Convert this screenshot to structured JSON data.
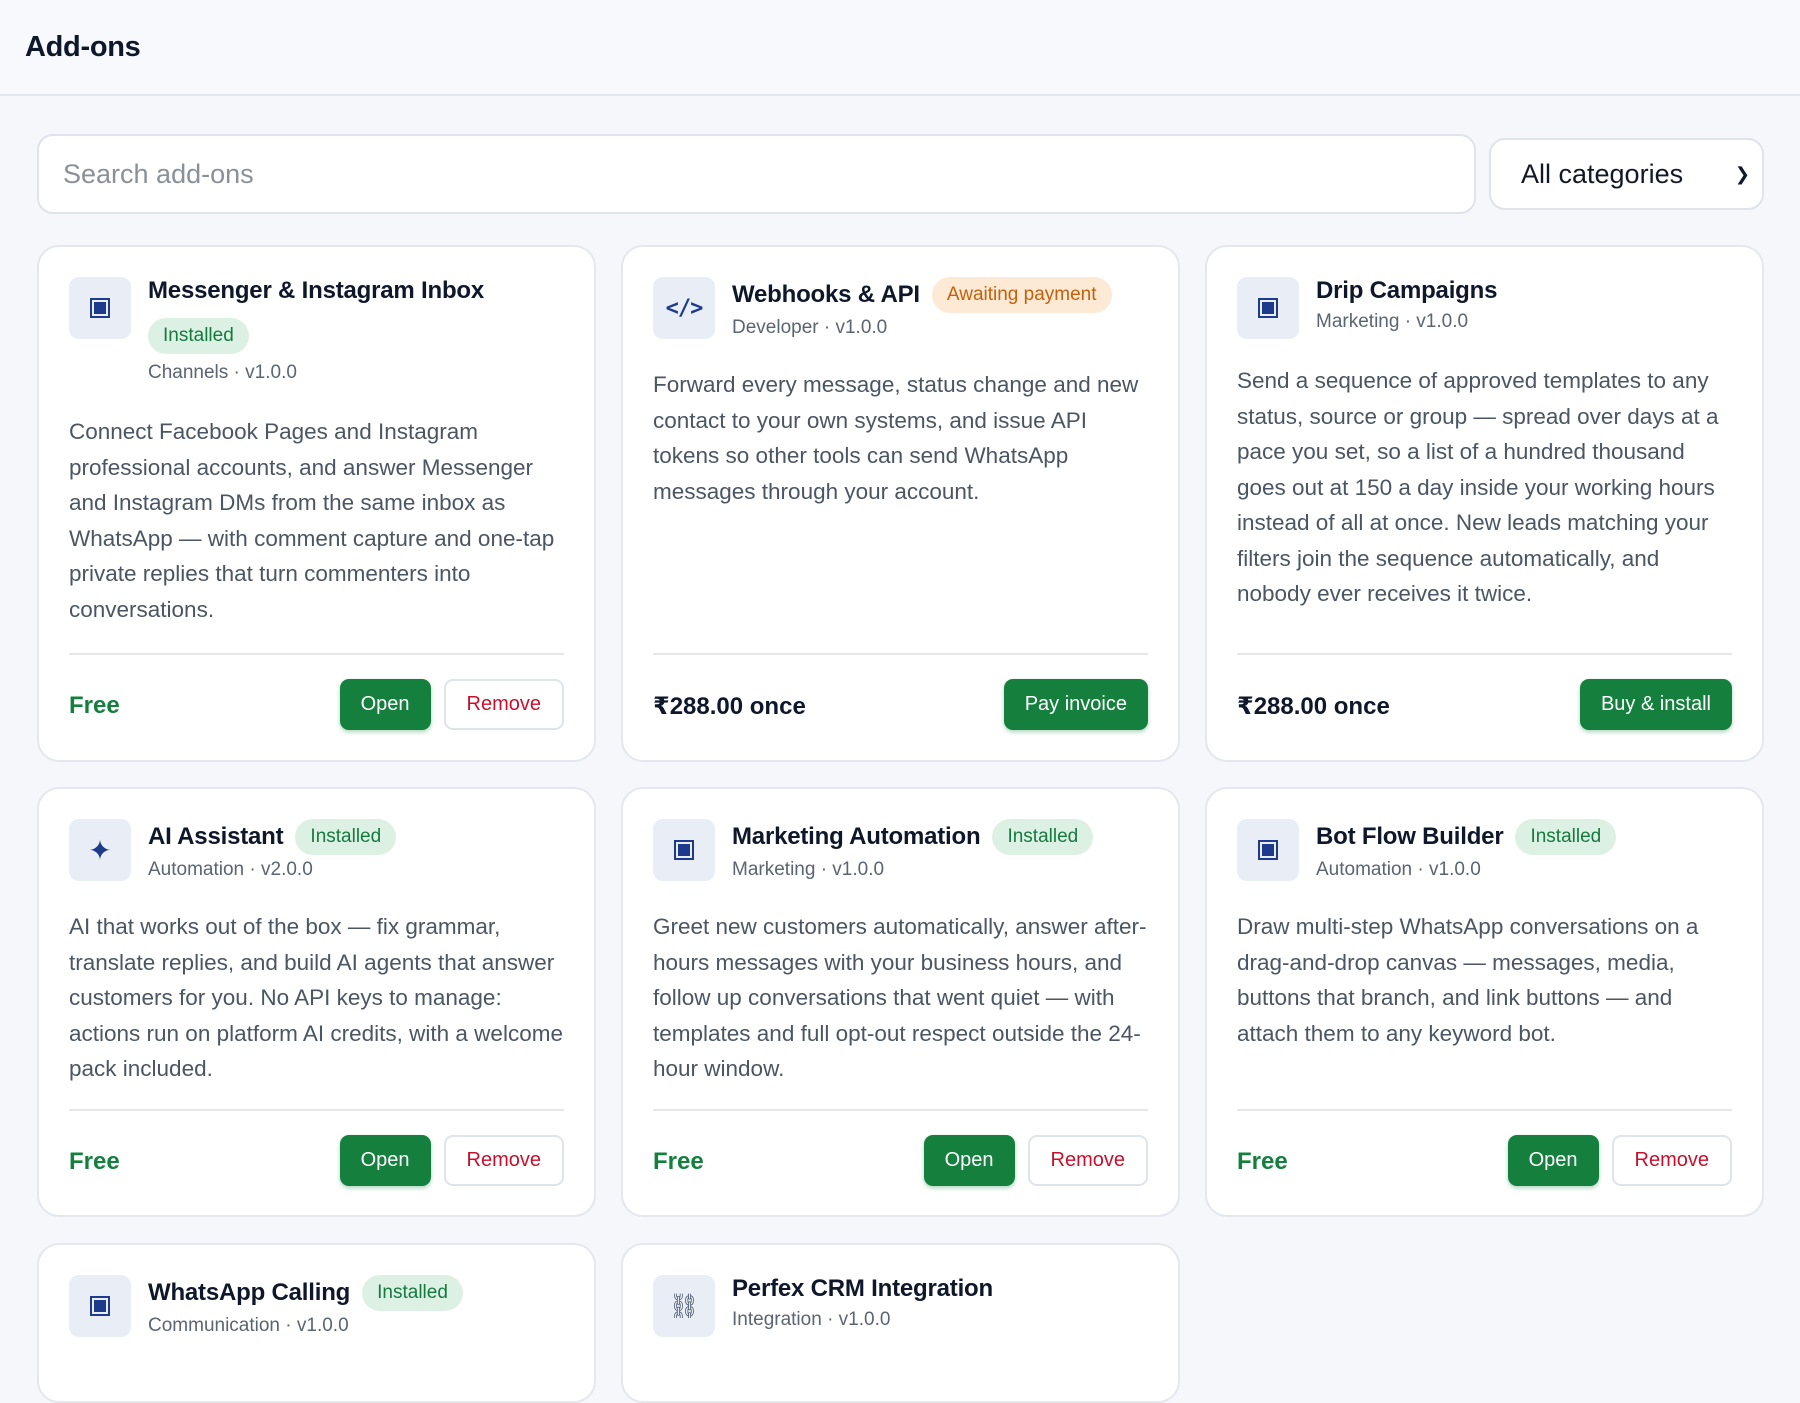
{
  "header": {
    "title": "Add-ons"
  },
  "search": {
    "placeholder": "Search add-ons"
  },
  "category_filter": {
    "selected": "All categories"
  },
  "cards": [
    {
      "title": "Messenger & Instagram Inbox",
      "badge": "Installed",
      "meta": "Channels · v1.0.0",
      "description": "Connect Facebook Pages and Instagram professional accounts, and answer Messenger and Instagram DMs from the same inbox as WhatsApp — with comment capture and one-tap private replies that turn commenters into conversations.",
      "price": "Free",
      "primary_button": "Open",
      "secondary_button": "Remove",
      "icon": "square-icon"
    },
    {
      "title": "Webhooks & API",
      "badge": "Awaiting payment",
      "meta": "Developer · v1.0.0",
      "description": "Forward every message, status change and new contact to your own systems, and issue API tokens so other tools can send WhatsApp messages through your account.",
      "price": "₹288.00 once",
      "primary_button": "Pay invoice",
      "icon": "code-icon"
    },
    {
      "title": "Drip Campaigns",
      "meta": "Marketing · v1.0.0",
      "description": "Send a sequence of approved templates to any status, source or group — spread over days at a pace you set, so a list of a hundred thousand goes out at 150 a day inside your working hours instead of all at once. New leads matching your filters join the sequence automatically, and nobody ever receives it twice.",
      "price": "₹288.00 once",
      "primary_button": "Buy & install",
      "icon": "square-icon"
    },
    {
      "title": "AI Assistant",
      "badge": "Installed",
      "meta": "Automation · v2.0.0",
      "description": "AI that works out of the box — fix grammar, translate replies, and build AI agents that answer customers for you. No API keys to manage: actions run on platform AI credits, with a welcome pack included.",
      "price": "Free",
      "primary_button": "Open",
      "secondary_button": "Remove",
      "icon": "sparkle-icon"
    },
    {
      "title": "Marketing Automation",
      "badge": "Installed",
      "meta": "Marketing · v1.0.0",
      "description": "Greet new customers automatically, answer after-hours messages with your business hours, and follow up conversations that went quiet — with templates and full opt-out respect outside the 24-hour window.",
      "price": "Free",
      "primary_button": "Open",
      "secondary_button": "Remove",
      "icon": "square-icon"
    },
    {
      "title": "Bot Flow Builder",
      "badge": "Installed",
      "meta": "Automation · v1.0.0",
      "description": "Draw multi-step WhatsApp conversations on a drag-and-drop canvas — messages, media, buttons that branch, and link buttons — and attach them to any keyword bot.",
      "price": "Free",
      "primary_button": "Open",
      "secondary_button": "Remove",
      "icon": "square-icon"
    },
    {
      "title": "WhatsApp Calling",
      "badge": "Installed",
      "meta": "Communication · v1.0.0",
      "icon": "square-icon"
    },
    {
      "title": "Perfex CRM Integration",
      "meta": "Integration · v1.0.0",
      "icon": "link-icon"
    }
  ]
}
